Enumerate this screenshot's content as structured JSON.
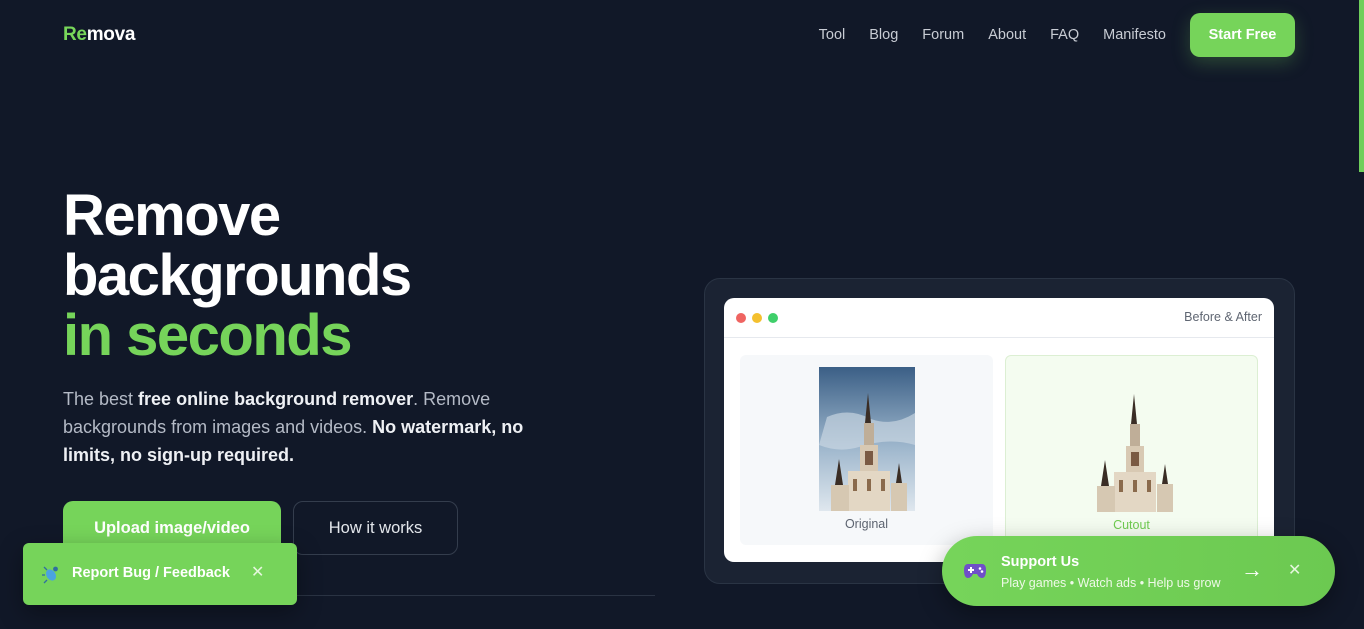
{
  "logo": {
    "accent": "Re",
    "rest": "mova"
  },
  "nav": {
    "links": [
      "Tool",
      "Blog",
      "Forum",
      "About",
      "FAQ",
      "Manifesto"
    ],
    "cta": "Start Free"
  },
  "hero": {
    "title_line1": "Remove",
    "title_line2": "backgrounds",
    "title_line3": "in seconds",
    "sub": {
      "p1": "The best ",
      "b1": "free online background remover",
      "p2": ". Remove backgrounds from images and videos. ",
      "b2": "No watermark, no limits, no sign-up required."
    },
    "upload_label": "Upload image/video",
    "how_label": "How it works"
  },
  "preview": {
    "window_title": "Before & After",
    "original_label": "Original",
    "cutout_label": "Cutout"
  },
  "toast_report": {
    "label": "Report Bug / Feedback",
    "close": "✕",
    "icon": "bug-icon"
  },
  "toast_support": {
    "title": "Support Us",
    "desc": "Play games • Watch ads • Help us grow",
    "arrow": "→",
    "close": "✕",
    "icon": "gamepad-icon"
  },
  "colors": {
    "background": "#111828",
    "accent": "#76d45a",
    "panel": "#1b2333",
    "muted_text": "#b4bac6"
  }
}
